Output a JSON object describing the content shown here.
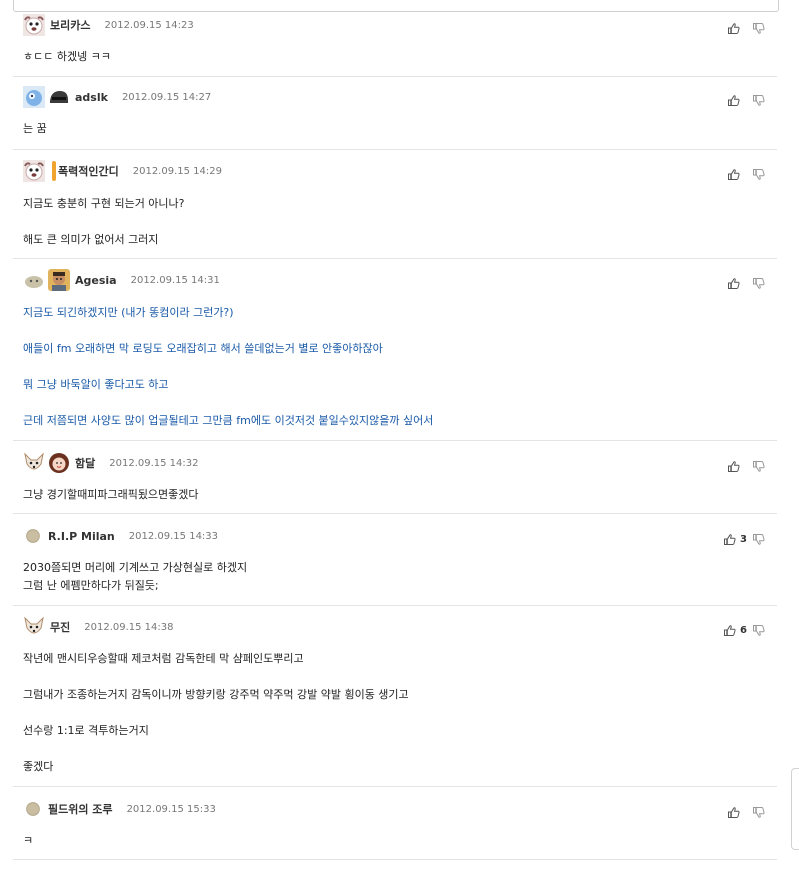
{
  "comments": [
    {
      "user": "보리카스",
      "date": "2012.09.15 14:23",
      "lines": [
        "ㅎㄷㄷ 하겠넹 ㅋㅋ"
      ],
      "votes": ""
    },
    {
      "user": "adslk",
      "date": "2012.09.15 14:27",
      "lines": [
        "는 꿈"
      ],
      "votes": ""
    },
    {
      "user": "폭력적인간디",
      "date": "2012.09.15 14:29",
      "lines": [
        "지금도 충분히 구현 되는거 아니나?",
        "",
        "해도 큰 의미가 없어서 그러지"
      ],
      "votes": ""
    },
    {
      "user": "Agesia",
      "date": "2012.09.15 14:31",
      "lines": [
        "지금도 되긴하겠지만 (내가 똥컴이라 그런가?)",
        "",
        "애들이 fm 오래하면 막 로딩도 오래잡히고 해서 쓸데없는거 별로 안좋아하잖아",
        "",
        "뭐 그냥 바둑알이 좋다고도 하고",
        "",
        "근데 저쯤되면 사양도 많이 업글될테고 그만큼 fm에도 이것저것 붙일수있지않을까 싶어서"
      ],
      "votes": ""
    },
    {
      "user": "함달",
      "date": "2012.09.15 14:32",
      "lines": [
        "그냥 경기할때피파그래픽됬으면좋겠다"
      ],
      "votes": ""
    },
    {
      "user": "R.I.P Milan",
      "date": "2012.09.15 14:33",
      "lines": [
        "2030쯤되면 머리에 기계쓰고 가상현실로 하겠지",
        "그럼 난 에펨만하다가 뒤질듯;"
      ],
      "votes": "3"
    },
    {
      "user": "무진",
      "date": "2012.09.15 14:38",
      "lines": [
        "작년에 맨시티우승할때 제코처럼 감독한테 막 샴페인도뿌리고",
        "",
        "그럼내가 조종하는거지 감독이니까 방향키랑 강주먹 약주먹 강발 약발 횡이동 생기고",
        "",
        "선수랑 1:1로 격투하는거지",
        "",
        "좋겠다"
      ],
      "votes": "6"
    },
    {
      "user": "필드위의 조루",
      "date": "2012.09.15 15:33",
      "lines": [
        "ㅋ"
      ],
      "votes": ""
    }
  ],
  "icons": {
    "like": "thumbs-up-icon",
    "dislike": "thumbs-down-icon"
  },
  "colors": {
    "link_text": "#1a5aa8",
    "accent_tag": "#f1a330"
  }
}
